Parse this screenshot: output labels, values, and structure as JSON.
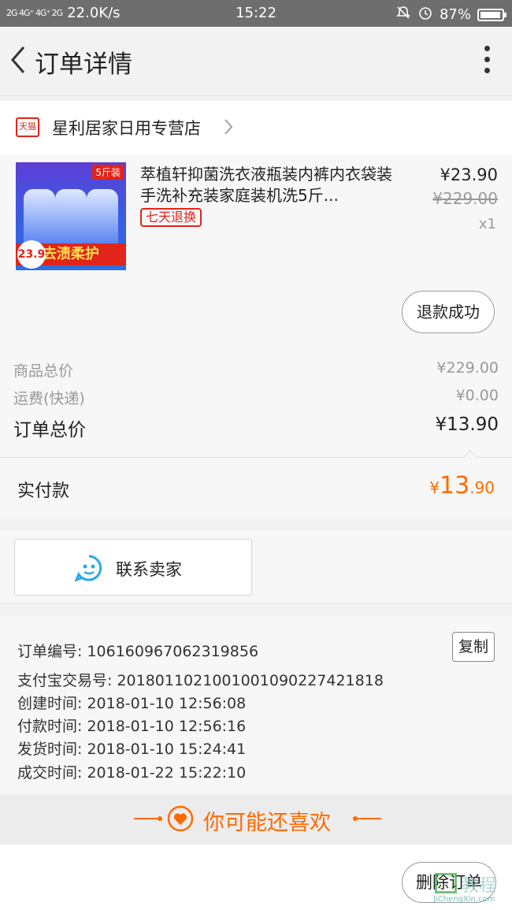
{
  "status_bar": {
    "signal_left": "2G 4G⁺ 4G⁺ 2G",
    "speed": "22.0K/s",
    "time": "15:22",
    "battery": "87%"
  },
  "header": {
    "title": "订单详情",
    "back_icon": "chevron-left-icon",
    "more_icon": "more-vertical-icon"
  },
  "shop": {
    "badge": "天猫",
    "name": "星利居家日用专营店"
  },
  "product": {
    "title": "萃植轩抑菌洗衣液瓶装内裤内衣袋装手洗补充装家庭装机洗5斤...",
    "image_tag": "5斤装",
    "image_slogan": "去渍柔护",
    "image_price": "23.9",
    "return_badge": "七天退换",
    "price": "¥23.90",
    "original_price": "¥229.00",
    "quantity": "x1",
    "refund_status": "退款成功"
  },
  "totals": {
    "goods_label": "商品总价",
    "goods_value": "¥229.00",
    "shipping_label": "运费(快递)",
    "shipping_value": "¥0.00",
    "order_total_label": "订单总价",
    "order_total_value": "¥13.90"
  },
  "payment": {
    "label": "实付款",
    "currency": "¥",
    "integer": "13",
    "decimal": ".90",
    "accent_color": "#ff6a00"
  },
  "contact": {
    "label": "联系卖家",
    "icon": "chat-face-icon"
  },
  "order_info": {
    "order_no": "订单编号: 106160967062319856",
    "copy_label": "复制",
    "alipay_no": "支付宝交易号: 2018011021001001090227421818",
    "created": "创建时间: 2018-01-10 12:56:08",
    "paid": "付款时间: 2018-01-10 12:56:16",
    "shipped": "发货时间: 2018-01-10 15:24:41",
    "completed": "成交时间: 2018-01-22 15:22:10"
  },
  "recommend": {
    "label": "你可能还喜欢",
    "icon": "heart-icon"
  },
  "footer": {
    "delete_label": "删除订单",
    "watermark": "教程",
    "watermark_sub": "JiChengXin.com"
  }
}
